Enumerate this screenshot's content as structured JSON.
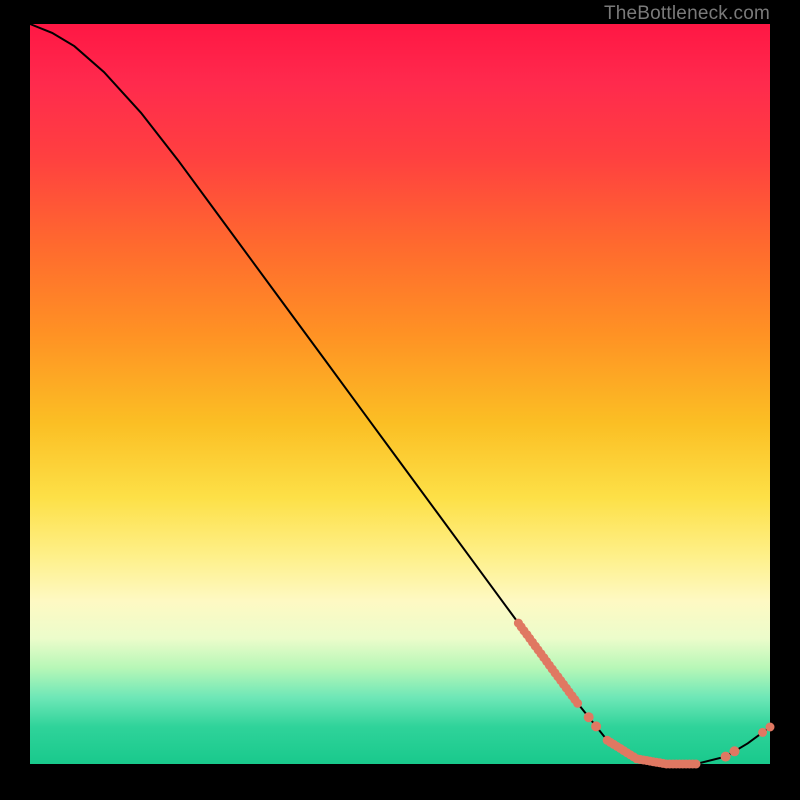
{
  "attribution": "TheBottleneck.com",
  "colors": {
    "marker": "#e07862",
    "curve": "#000000"
  },
  "chart_data": {
    "type": "line",
    "title": "",
    "xlabel": "",
    "ylabel": "",
    "xlim": [
      0,
      100
    ],
    "ylim": [
      0,
      100
    ],
    "grid": false,
    "curve": [
      {
        "x": 0,
        "y": 100
      },
      {
        "x": 3,
        "y": 98.8
      },
      {
        "x": 6,
        "y": 97.0
      },
      {
        "x": 10,
        "y": 93.5
      },
      {
        "x": 15,
        "y": 88.0
      },
      {
        "x": 20,
        "y": 81.6
      },
      {
        "x": 25,
        "y": 74.8
      },
      {
        "x": 30,
        "y": 68.0
      },
      {
        "x": 35,
        "y": 61.2
      },
      {
        "x": 40,
        "y": 54.4
      },
      {
        "x": 45,
        "y": 47.6
      },
      {
        "x": 50,
        "y": 40.8
      },
      {
        "x": 55,
        "y": 34.0
      },
      {
        "x": 60,
        "y": 27.2
      },
      {
        "x": 65,
        "y": 20.4
      },
      {
        "x": 70,
        "y": 13.6
      },
      {
        "x": 74,
        "y": 8.2
      },
      {
        "x": 78,
        "y": 3.2
      },
      {
        "x": 82,
        "y": 0.7
      },
      {
        "x": 86,
        "y": 0.0
      },
      {
        "x": 90,
        "y": 0.0
      },
      {
        "x": 94,
        "y": 1.0
      },
      {
        "x": 97,
        "y": 2.8
      },
      {
        "x": 100,
        "y": 5.0
      }
    ],
    "markers_dense_segments": [
      {
        "x_start": 66,
        "x_end": 74,
        "count": 22,
        "r": 4.5
      },
      {
        "x_start": 78,
        "x_end": 90,
        "count": 28,
        "r": 4.5
      }
    ],
    "markers_sparse": [
      {
        "x": 75.5,
        "r": 5
      },
      {
        "x": 76.5,
        "r": 5
      },
      {
        "x": 94,
        "r": 5
      },
      {
        "x": 95.2,
        "r": 5
      },
      {
        "x": 99,
        "r": 4.5
      },
      {
        "x": 100,
        "r": 4.5
      }
    ]
  }
}
